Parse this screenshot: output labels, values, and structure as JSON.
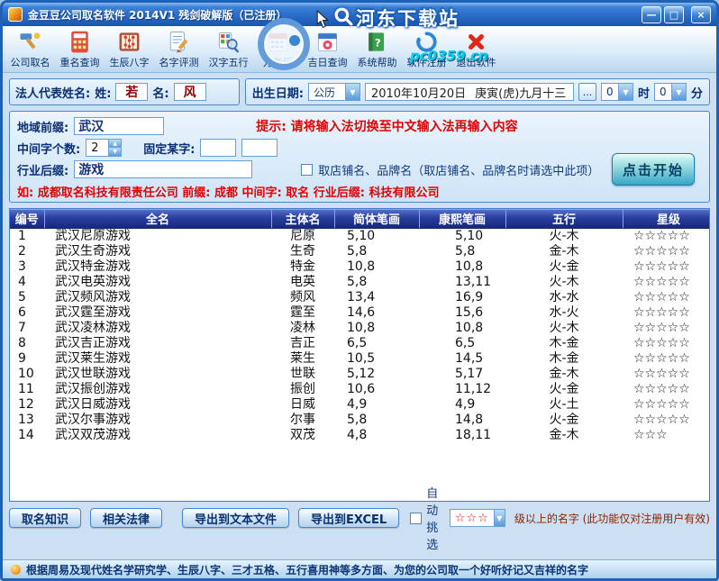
{
  "window": {
    "title": "金豆豆公司取名软件  2014V1 残剑破解版（已注册）",
    "buttons": {
      "minimize": "—",
      "maximize": "□",
      "close": "×"
    }
  },
  "watermarks": {
    "top": "河东下载站",
    "site": "pc0359.cn"
  },
  "toolbar": {
    "items": [
      {
        "label": "公司取名"
      },
      {
        "label": "重名查询"
      },
      {
        "label": "生辰八字"
      },
      {
        "label": "名字评测"
      },
      {
        "label": "汉字五行"
      },
      {
        "label": "万年历"
      },
      {
        "label": "吉日查询"
      },
      {
        "label": "系统帮助"
      },
      {
        "label": "软件注册"
      },
      {
        "label": "退出软件"
      }
    ]
  },
  "legal": {
    "label": "法人代表姓名:",
    "surname_label": "姓:",
    "surname": "若",
    "given_label": "名:",
    "given": "风"
  },
  "birth": {
    "label": "出生日期:",
    "calendar": "公历",
    "date": "2010年10月20日",
    "lunar": "庚寅(虎)九月十三",
    "more": "...",
    "hour": "0",
    "hour_unit": "时",
    "minute": "0",
    "minute_unit": "分"
  },
  "form": {
    "region_label": "地域前缀:",
    "region": "武汉",
    "tip": "提示: 请将输入法切换至中文输入法再输入内容",
    "middle_label": "中间字个数:",
    "middle_count": "2",
    "fixed_label": "固定某字:",
    "fixed_1": "",
    "fixed_2": "",
    "industry_label": "行业后缀:",
    "industry": "游戏",
    "shop_option": "取店铺名、品牌名（取店铺名、品牌名时请选中此项）",
    "example": "如: 成都取名科技有限责任公司  前缀: 成都  中间字: 取名  行业后缀: 科技有限公司",
    "start": "点击开始"
  },
  "table": {
    "headers": [
      "编号",
      "全名",
      "主体名",
      "简体笔画",
      "康熙笔画",
      "五行",
      "星级"
    ],
    "rows": [
      [
        "1",
        "武汉尼原游戏",
        "尼原",
        "5,10",
        "5,10",
        "火-木",
        "☆☆☆☆☆"
      ],
      [
        "2",
        "武汉生奇游戏",
        "生奇",
        "5,8",
        "5,8",
        "金-木",
        "☆☆☆☆☆"
      ],
      [
        "3",
        "武汉特金游戏",
        "特金",
        "10,8",
        "10,8",
        "火-金",
        "☆☆☆☆☆"
      ],
      [
        "4",
        "武汉电英游戏",
        "电英",
        "5,8",
        "13,11",
        "火-木",
        "☆☆☆☆☆"
      ],
      [
        "5",
        "武汉频风游戏",
        "频风",
        "13,4",
        "16,9",
        "水-水",
        "☆☆☆☆☆"
      ],
      [
        "6",
        "武汉霆至游戏",
        "霆至",
        "14,6",
        "15,6",
        "水-火",
        "☆☆☆☆☆"
      ],
      [
        "7",
        "武汉凌林游戏",
        "凌林",
        "10,8",
        "10,8",
        "火-木",
        "☆☆☆☆☆"
      ],
      [
        "8",
        "武汉吉正游戏",
        "吉正",
        "6,5",
        "6,5",
        "木-金",
        "☆☆☆☆☆"
      ],
      [
        "9",
        "武汉莱生游戏",
        "莱生",
        "10,5",
        "14,5",
        "木-金",
        "☆☆☆☆☆"
      ],
      [
        "10",
        "武汉世联游戏",
        "世联",
        "5,12",
        "5,17",
        "金-木",
        "☆☆☆☆☆"
      ],
      [
        "11",
        "武汉振创游戏",
        "振创",
        "10,6",
        "11,12",
        "火-金",
        "☆☆☆☆☆"
      ],
      [
        "12",
        "武汉日威游戏",
        "日威",
        "4,9",
        "4,9",
        "火-土",
        "☆☆☆☆☆"
      ],
      [
        "13",
        "武汉尔事游戏",
        "尔事",
        "5,8",
        "14,8",
        "火-金",
        "☆☆☆☆☆"
      ],
      [
        "14",
        "武汉双茂游戏",
        "双茂",
        "4,8",
        "18,11",
        "金-木",
        "☆☆☆"
      ]
    ]
  },
  "bottom": {
    "knowledge": "取名知识",
    "laws": "相关法律",
    "export_txt": "导出到文本文件",
    "export_excel": "导出到EXCEL",
    "auto_pick": "自动挑选",
    "star_filter": "☆☆☆",
    "filter_suffix": "级以上的名字 (此功能仅对注册用户有效)"
  },
  "status": "根据周易及现代姓名学研究学、生辰八字、三才五格、五行喜用神等多方面、为您的公司取一个好听好记又吉祥的名字"
}
